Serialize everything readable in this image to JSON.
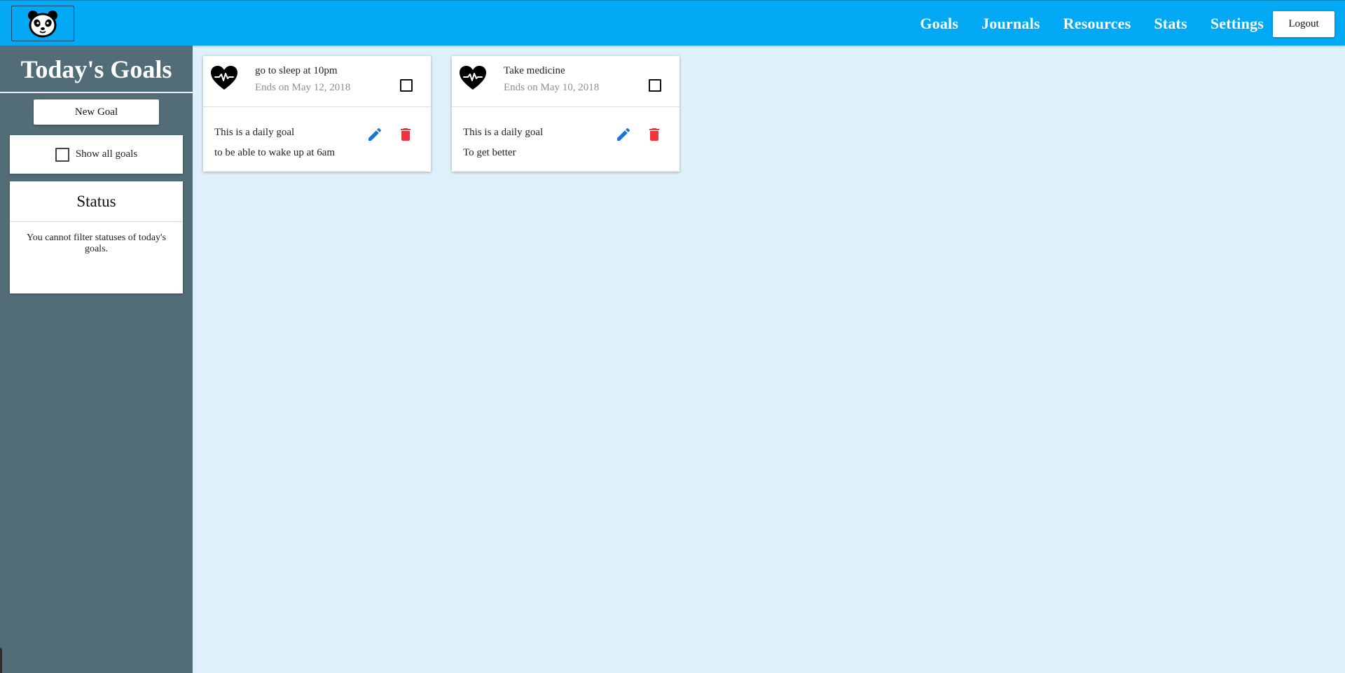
{
  "header": {
    "logo_icon": "panda-icon",
    "nav": [
      {
        "label": "Goals"
      },
      {
        "label": "Journals"
      },
      {
        "label": "Resources"
      },
      {
        "label": "Stats"
      },
      {
        "label": "Settings"
      }
    ],
    "logout_label": "Logout"
  },
  "sidebar": {
    "title": "Today's Goals",
    "new_goal_label": "New Goal",
    "show_all_label": "Show all goals",
    "show_all_checked": false,
    "status_title": "Status",
    "status_text": "You cannot filter statuses of today's goals."
  },
  "goals": [
    {
      "icon": "heart-pulse-icon",
      "title": "go to sleep at 10pm",
      "ends": "Ends on May 12, 2018",
      "frequency": "This is a daily goal",
      "reason": "to be able to wake up at 6am",
      "completed": false
    },
    {
      "icon": "heart-pulse-icon",
      "title": "Take medicine",
      "ends": "Ends on May 10, 2018",
      "frequency": "This is a daily goal",
      "reason": "To get better",
      "completed": false
    }
  ],
  "colors": {
    "header_bg": "#03a9f4",
    "sidebar_bg": "#526c78",
    "page_bg": "#dff0fb",
    "edit_icon": "#1976d2",
    "delete_icon": "#f4333c"
  }
}
